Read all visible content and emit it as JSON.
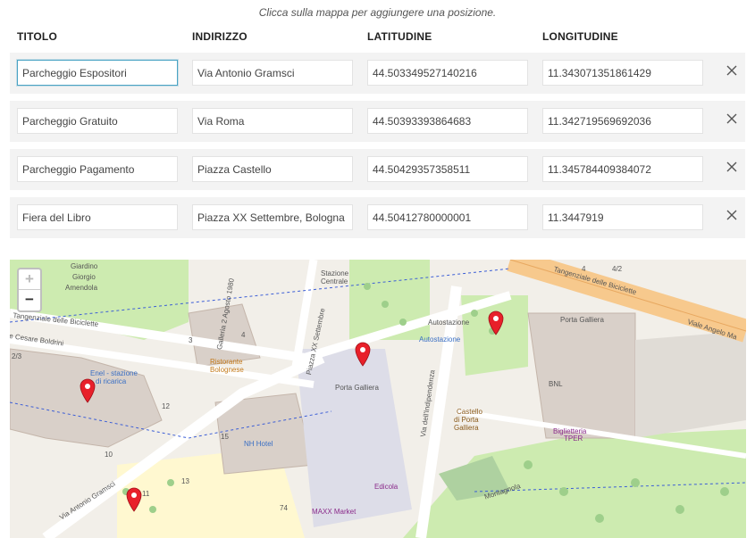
{
  "hint": "Clicca sulla mappa per aggiungere una posizione.",
  "columns": {
    "titolo": "TITOLO",
    "indirizzo": "INDIRIZZO",
    "latitudine": "LATITUDINE",
    "longitudine": "LONGITUDINE"
  },
  "rows": [
    {
      "titolo": "Parcheggio Espositori",
      "indirizzo": "Via Antonio Gramsci",
      "latitudine": "44.503349527140216",
      "longitudine": "11.343071351861429"
    },
    {
      "titolo": "Parcheggio Gratuito",
      "indirizzo": "Via Roma",
      "latitudine": "44.50393393864683",
      "longitudine": "11.342719569692036"
    },
    {
      "titolo": "Parcheggio Pagamento",
      "indirizzo": "Piazza Castello",
      "latitudine": "44.50429357358511",
      "longitudine": "11.345784409384072"
    },
    {
      "titolo": "Fiera del Libro",
      "indirizzo": "Piazza XX Settembre, Bologna E",
      "latitudine": "44.50412780000001",
      "longitudine": "11.3447919"
    }
  ],
  "map": {
    "zoom_in": "+",
    "zoom_out": "−",
    "marker_color": "#e8202a",
    "labels": {
      "giardino": "Giardino",
      "giorgio": "Giorgio",
      "amendola": "Amendola",
      "tangenziale_left": "Tangenziale delle Biciclette",
      "tangenziale_right": "Tangenziale delle Biciclette",
      "cesare": "e Cesare Boldrini",
      "galleria": "Galleria 2 Agosto 1980",
      "piazza_xx": "Piazza XX Settembre",
      "stazione": "Stazione",
      "centrale": "Centrale",
      "autostazione": "Autostazione",
      "autostazione2": "Autostazione",
      "porta_galliera_right": "Porta Galliera",
      "viale": "Viale Angelo Ma",
      "ristorante": "Ristorante",
      "bolognese": "Bolognese",
      "enel1": "Enel - stazione",
      "enel2": "di ricarica",
      "porta_galliera": "Porta Galliera",
      "via_indip": "Via dell'Indipendenza",
      "castello1": "Castello",
      "castello2": "di Porta",
      "castello3": "Galliera",
      "bnl": "BNL",
      "biglietteria1": "Biglietteria",
      "biglietteria2": "TPER",
      "nh": "NH Hotel",
      "edicola": "Edicola",
      "via_gramsci": "Via Antonio Gramsci",
      "montagnola": "Montagnola",
      "maxi": "MAXX Market",
      "n3": "3",
      "n4": "4",
      "n12": "12",
      "n10": "10",
      "n13": "13",
      "n15": "15",
      "n74": "74",
      "n11": "11",
      "n23": "2/3",
      "n42": "4/2",
      "n4b": "4"
    }
  }
}
